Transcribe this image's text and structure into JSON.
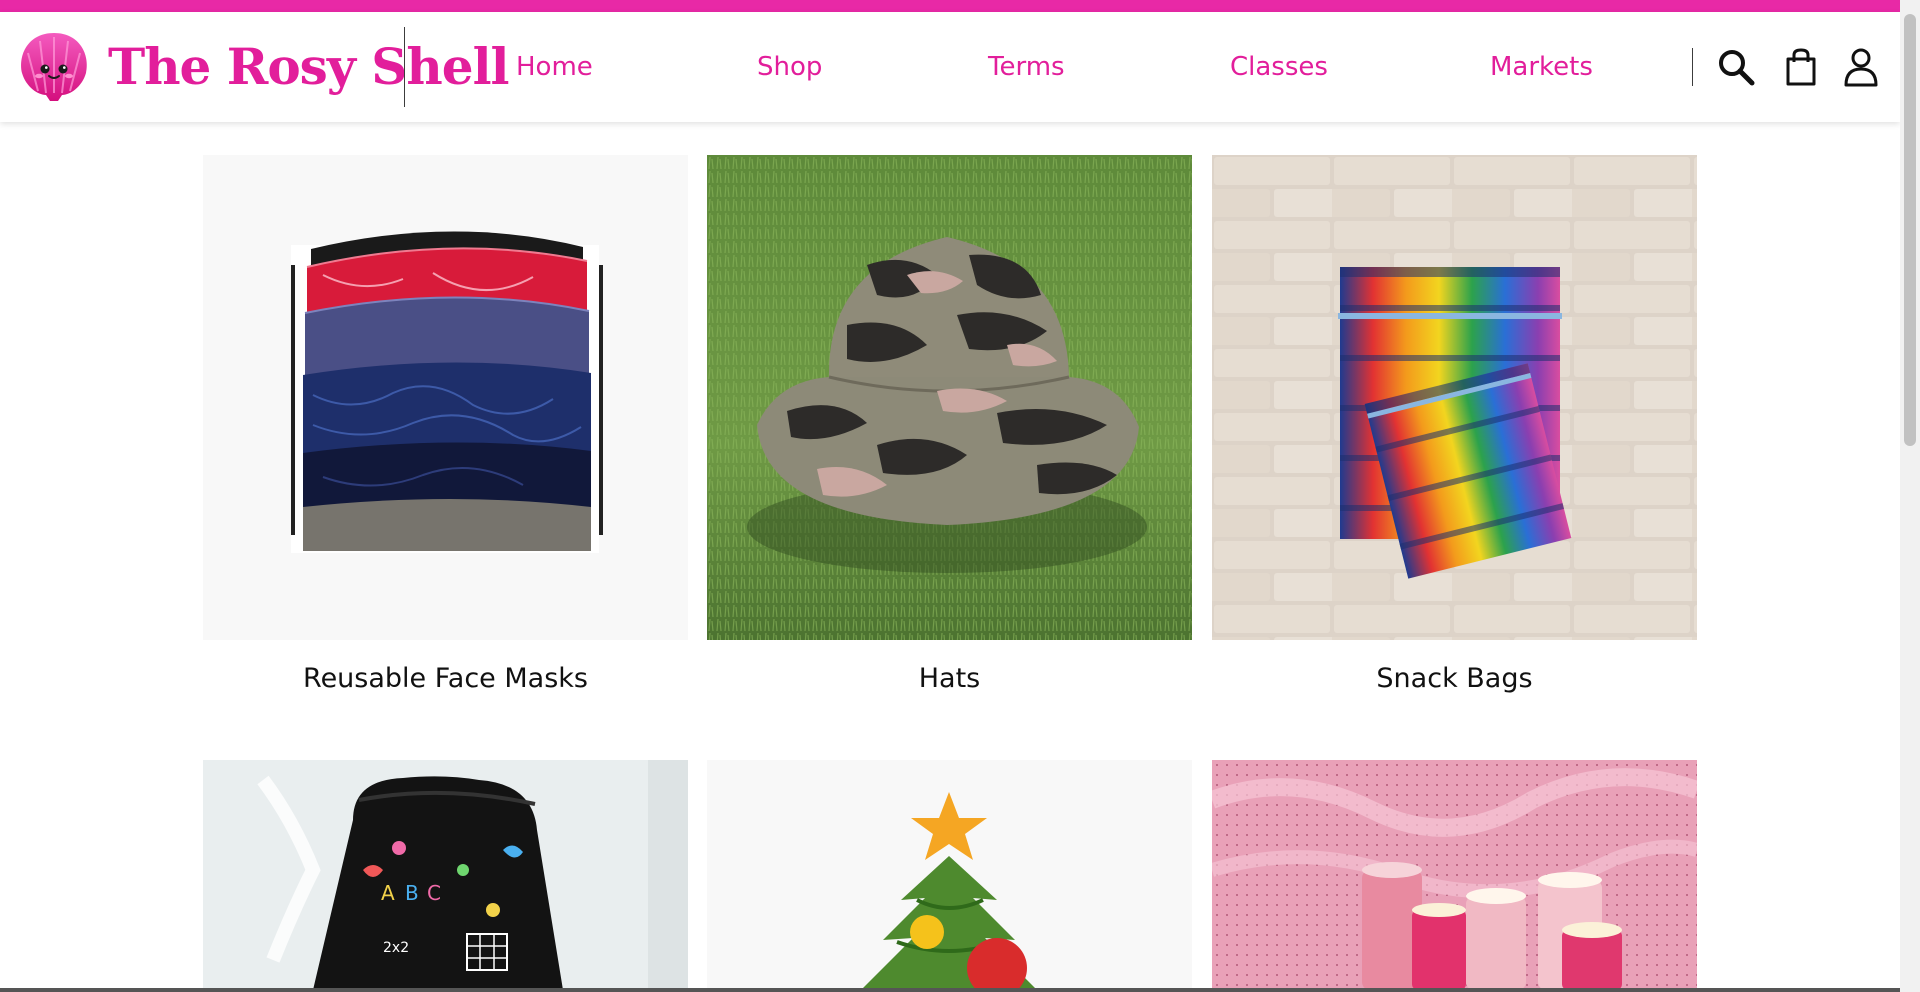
{
  "brand": {
    "name": "The Rosy Shell",
    "accent_color": "#e21e9b",
    "logo_icon": "seashell-logo-icon"
  },
  "nav": {
    "items": [
      {
        "label": "Home"
      },
      {
        "label": "Shop"
      },
      {
        "label": "Terms"
      },
      {
        "label": "Classes"
      },
      {
        "label": "Markets"
      }
    ]
  },
  "header_icons": [
    {
      "name": "search-icon"
    },
    {
      "name": "shopping-bag-icon"
    },
    {
      "name": "user-account-icon"
    }
  ],
  "categories": [
    {
      "label": "Reusable Face Masks",
      "image": "stacked-face-masks-image"
    },
    {
      "label": "Hats",
      "image": "camo-bucket-hat-image"
    },
    {
      "label": "Snack Bags",
      "image": "crayon-print-snack-bags-image"
    },
    {
      "label": "",
      "image": "drawstring-bag-image"
    },
    {
      "label": "",
      "image": "christmas-tree-image"
    },
    {
      "label": "",
      "image": "thread-spools-on-pink-tulle-image"
    }
  ]
}
